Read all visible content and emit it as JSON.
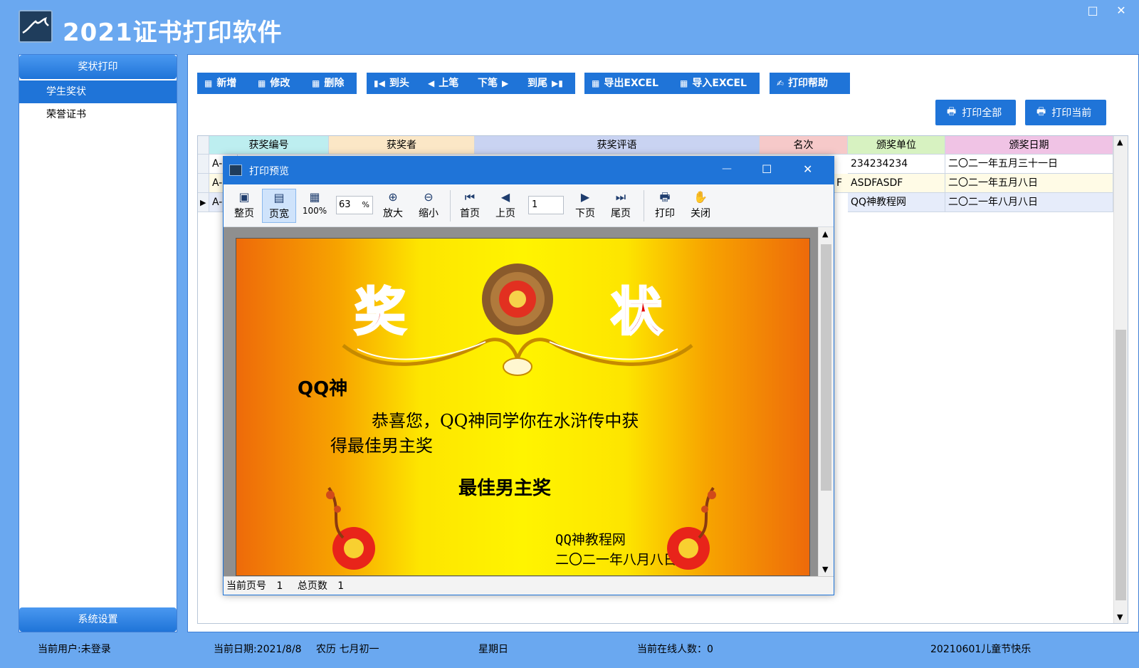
{
  "app": {
    "title": "2021证书打印软件",
    "win_restore": "□",
    "win_close": "✕"
  },
  "sidebar": {
    "header": "奖状打印",
    "items": [
      {
        "label": "学生奖状",
        "active": true
      },
      {
        "label": "荣誉证书",
        "active": false
      }
    ],
    "footer": "系统设置"
  },
  "toolbar": {
    "add": "新增",
    "edit": "修改",
    "delete": "删除",
    "first": "到头",
    "prev": "上笔",
    "next": "下笔",
    "last": "到尾",
    "export_excel": "导出EXCEL",
    "import_excel": "导入EXCEL",
    "print_help": "打印帮助",
    "print_all": "打印全部",
    "print_current": "打印当前"
  },
  "grid": {
    "columns": [
      "获奖编号",
      "获奖者",
      "获奖评语",
      "名次",
      "颁奖单位",
      "颁奖日期"
    ],
    "column_colors": [
      "#bdeef0",
      "#fbe7c6",
      "#c9d3f2",
      "#f6c9c9",
      "#d7f2c1",
      "#f0c3e5"
    ],
    "rows": [
      {
        "id": "A-",
        "org_tail": "",
        "org": "234234234",
        "date": "二〇二一年五月三十一日"
      },
      {
        "id": "A-",
        "org_tail": "F",
        "org": "ASDFASDF",
        "date": "二〇二一年五月八日"
      },
      {
        "id": "A-",
        "org_tail": "",
        "org": "QQ神教程网",
        "date": "二〇二一年八月八日",
        "current": true
      }
    ]
  },
  "preview": {
    "title": "打印预览",
    "min": "—",
    "max": "☐",
    "close": "✕",
    "buttons": {
      "whole_page": "整页",
      "page_width": "页宽",
      "pct100": "100%",
      "zoom_in": "放大",
      "zoom_out": "缩小",
      "first_page": "首页",
      "prev_page": "上页",
      "next_page": "下页",
      "last_page": "尾页",
      "print": "打印",
      "close_btn": "关闭"
    },
    "zoom_value": "63",
    "zoom_unit": "%",
    "page_input": "1",
    "certificate": {
      "title_left": "奖",
      "title_right": "状",
      "recipient": "QQ神",
      "line1": "恭喜您，QQ神同学你在水浒传中获",
      "line2": "得最佳男主奖",
      "award": "最佳男主奖",
      "issuer": "QQ神教程网",
      "date": "二〇二一年八月八日"
    },
    "status": {
      "cur_label": "当前页号",
      "cur_value": "1",
      "total_label": "总页数",
      "total_value": "1"
    }
  },
  "statusbar": {
    "user": "当前用户:未登录",
    "date": "当前日期:2021/8/8",
    "lunar": "农历 七月初一",
    "weekday": "星期日",
    "online": "当前在线人数：0",
    "notice": "20210601儿童节快乐"
  }
}
